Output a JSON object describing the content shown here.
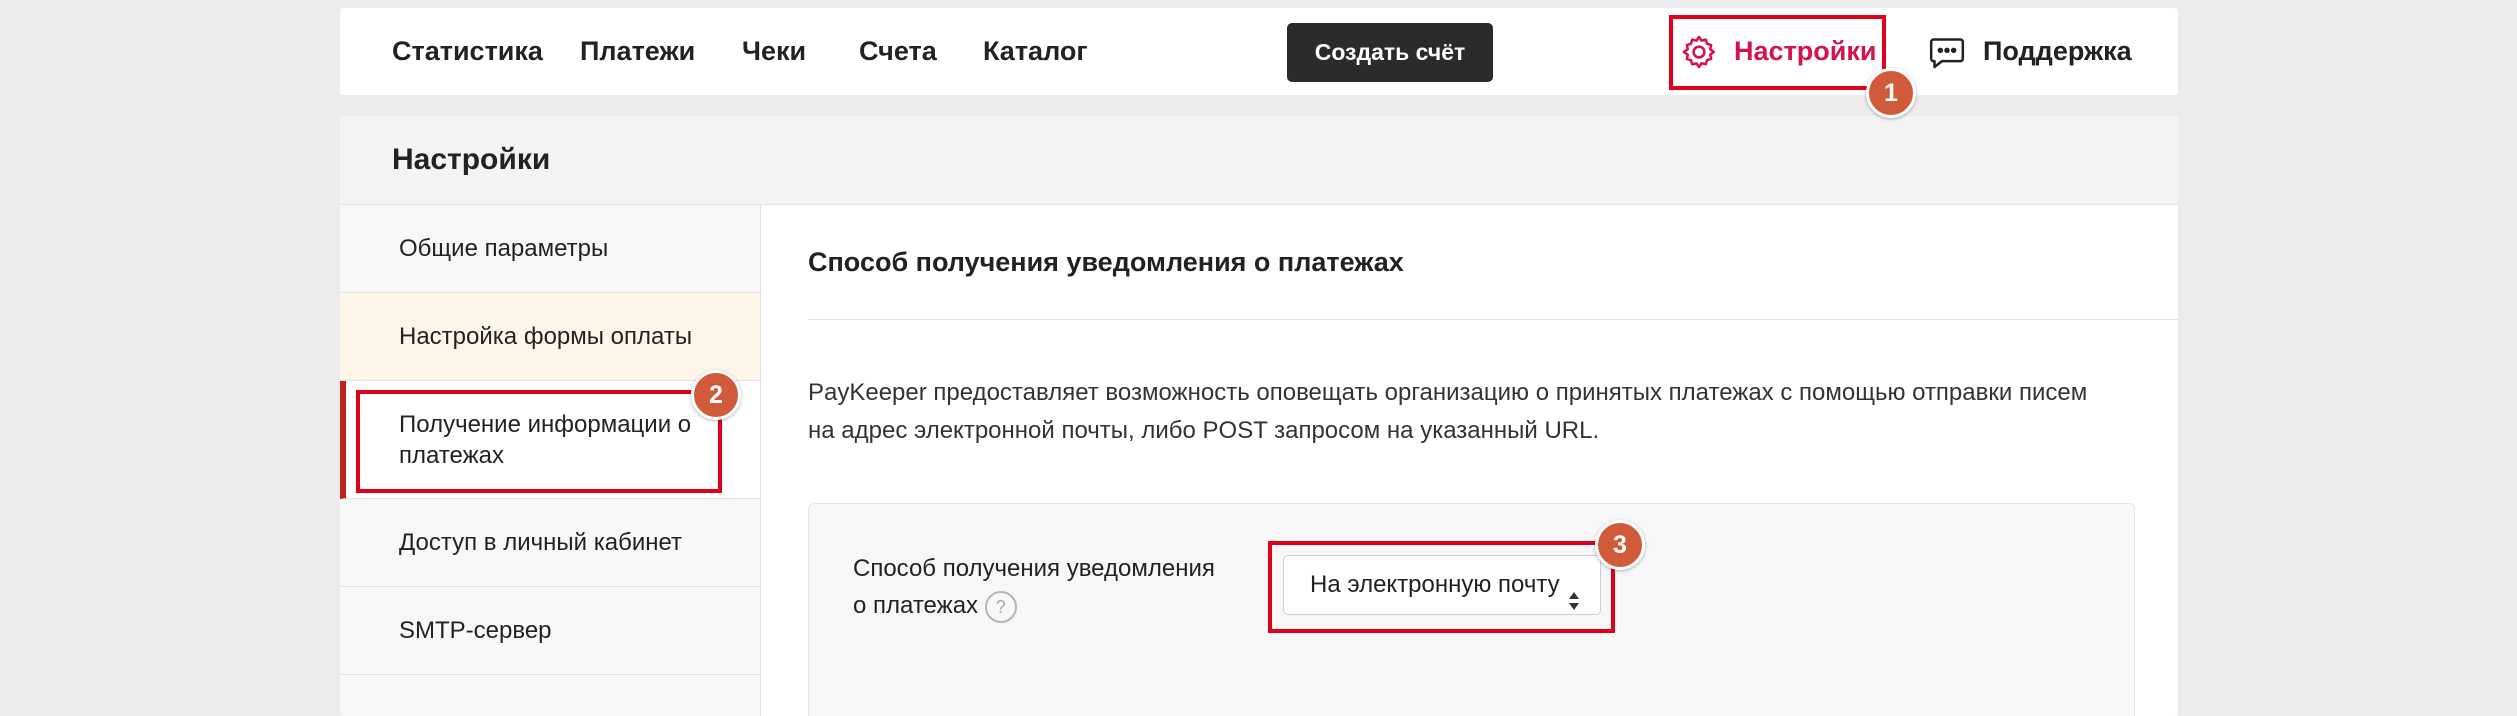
{
  "topnav": {
    "items": [
      "Статистика",
      "Платежи",
      "Чеки",
      "Счета",
      "Каталог"
    ],
    "create_invoice": "Создать счёт",
    "settings": "Настройки",
    "support": "Поддержка"
  },
  "page": {
    "title": "Настройки"
  },
  "sidebar": {
    "items": [
      {
        "label": "Общие параметры"
      },
      {
        "label": "Настройка формы оплаты"
      },
      {
        "label": "Получение информации о платежах"
      },
      {
        "label": "Доступ в личный кабинет"
      },
      {
        "label": "SMTP-сервер"
      }
    ]
  },
  "content": {
    "section_title": "Способ получения уведомления о платежах",
    "description": "PayKeeper предоставляет возможность оповещать организацию о принятых платежах с помощью отправки писем на адрес электронной почты, либо POST запросом на указанный URL.",
    "field_label": "Способ получения уведомления о платежах",
    "help": "?",
    "select_value": "На электронную почту"
  },
  "annotations": {
    "step1": "1",
    "step2": "2",
    "step3": "3"
  },
  "colors": {
    "accent": "#d4134c",
    "highlight": "#e0001b",
    "badge": "#d05a3a",
    "active_bar": "#b8251a"
  },
  "icons": {
    "settings": "gear-icon",
    "support": "chat-bubble-icon",
    "select": "sort-arrows-icon"
  }
}
